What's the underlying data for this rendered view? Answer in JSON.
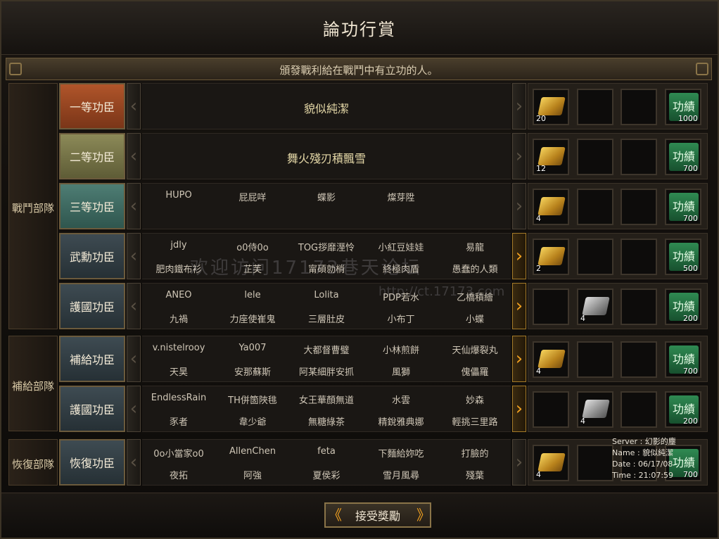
{
  "window": {
    "title": "論功行賞",
    "description": "頒發戰利給在戰鬥中有立功的人。"
  },
  "departments": [
    {
      "label": "戰鬥部隊"
    },
    {
      "label": "補給部隊"
    },
    {
      "label": "恢復部隊"
    }
  ],
  "rows": [
    {
      "rank": "一等功臣",
      "names": [
        "貌似純潔"
      ],
      "right_arrow_active": false,
      "rewards": [
        {
          "icon": "gold-bars-icon",
          "count": "20"
        },
        null,
        null,
        {
          "icon": "merit-icon",
          "label": "功績",
          "count": "1000"
        }
      ]
    },
    {
      "rank": "二等功臣",
      "names": [
        "舞火殘刃積飄雪"
      ],
      "right_arrow_active": false,
      "rewards": [
        {
          "icon": "gold-bars-icon",
          "count": "12"
        },
        null,
        null,
        {
          "icon": "merit-icon",
          "label": "功績",
          "count": "700"
        }
      ]
    },
    {
      "rank": "三等功臣",
      "names": [
        "HUPO",
        "屁屁咩",
        "蝶影",
        "燦芽陞"
      ],
      "right_arrow_active": false,
      "rewards": [
        {
          "icon": "gold-bars-icon",
          "count": "4"
        },
        null,
        null,
        {
          "icon": "merit-icon",
          "label": "功績",
          "count": "700"
        }
      ]
    },
    {
      "rank": "武勳功臣",
      "names": [
        "jdly",
        "o0侍0o",
        "TOG拶靡溼怜",
        "小紅豆娃娃",
        "易龍",
        "肥肉鐵布衫",
        "芷芙",
        "甯碩勍梢",
        "終極肉盾",
        "愚蠢的人類"
      ],
      "right_arrow_active": true,
      "rewards": [
        {
          "icon": "gold-bars-icon",
          "count": "2"
        },
        null,
        null,
        {
          "icon": "merit-icon",
          "label": "功績",
          "count": "500"
        }
      ]
    },
    {
      "rank": "護國功臣",
      "names": [
        "ANEO",
        "lele",
        "Lolita",
        "PDP若水",
        "乙橋積繪",
        "九禍",
        "力座使崔鬼",
        "三層肚皮",
        "小布丁",
        "小蝶"
      ],
      "right_arrow_active": true,
      "rewards": [
        null,
        {
          "icon": "silver-bars-icon",
          "count": "4"
        },
        null,
        {
          "icon": "merit-icon",
          "label": "功績",
          "count": "200"
        }
      ]
    },
    {
      "rank": "補給功臣",
      "names": [
        "v.nistelrooy",
        "Ya007",
        "大都督曹璧",
        "小林煎餅",
        "天仙爆裂丸",
        "天昊",
        "安那蘇斯",
        "阿某細胖安抓",
        "風獅",
        "傀儡羅"
      ],
      "right_arrow_active": true,
      "rewards": [
        {
          "icon": "gold-bars-icon",
          "count": "4"
        },
        null,
        null,
        {
          "icon": "merit-icon",
          "label": "功績",
          "count": "700"
        }
      ]
    },
    {
      "rank": "護國功臣",
      "names": [
        "EndlessRain",
        "TH併箇陜毴",
        "女王華顏無道",
        "水雲",
        "妙森",
        "豕者",
        "韋少爺",
        "無糖綠茶",
        "精銳雅典娜",
        "輕挑三里路"
      ],
      "right_arrow_active": true,
      "rewards": [
        null,
        {
          "icon": "silver-bars-icon",
          "count": "4"
        },
        null,
        {
          "icon": "merit-icon",
          "label": "功績",
          "count": "200"
        }
      ]
    },
    {
      "rank": "恢復功臣",
      "names": [
        "0o小當家o0",
        "AllenChen",
        "feta",
        "下麵給妳吃",
        "打臉的",
        "夜拓",
        "阿強",
        "夏侯彩",
        "雪月風尋",
        "殘葉"
      ],
      "right_arrow_active": false,
      "rewards": [
        {
          "icon": "gold-bars-icon",
          "count": "4"
        },
        null,
        null,
        {
          "icon": "merit-icon",
          "label": "功績",
          "count": "700"
        }
      ]
    }
  ],
  "accept_button": {
    "label": "接受獎勵"
  },
  "info_overlay": {
    "server": "Server : 幻影的塵",
    "name": "Name : 貌似純潔",
    "date": "Date : 06/17/08",
    "time": "Time : 21:07:59"
  },
  "watermark": {
    "line1": "欢迎访问17173巷天论坛",
    "line2": "http://ct.17173.com"
  },
  "colors": {
    "accent_gold": "#f0a020",
    "rank1": "#b0552a",
    "rank2": "#8c8a58",
    "rank3": "#4e7d74",
    "rank_standard": "#3e4b52"
  }
}
